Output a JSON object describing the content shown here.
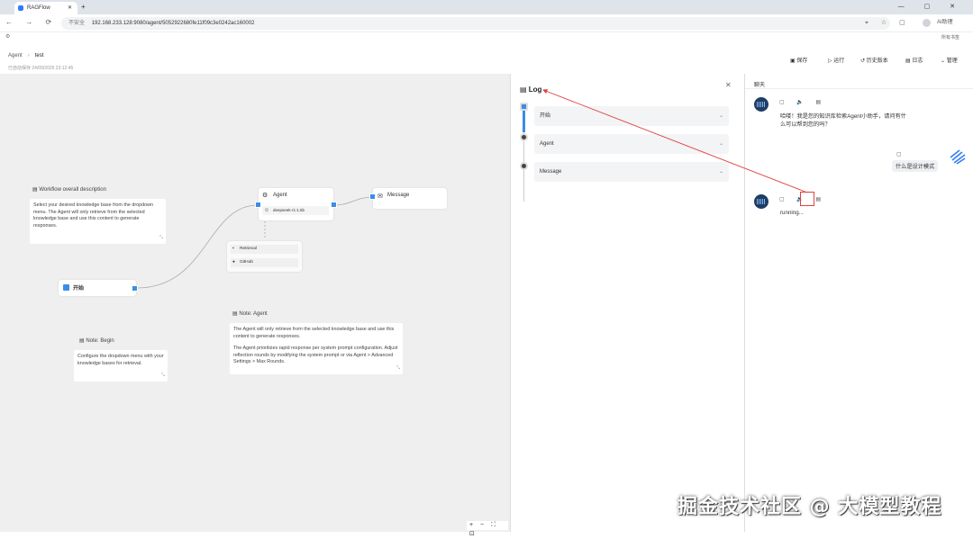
{
  "browser": {
    "tab_title": "RAGFlow",
    "url_prefix": "不安全",
    "url": "192.168.233.128:9080/agent/5052922680fe11f09c3e0242ac160002",
    "bookmark_right": "所有书签",
    "relaunch": "AI助理"
  },
  "header": {
    "crumb_root": "Agent",
    "crumb_current": "test",
    "saved_at": "已自动保存 24/09/2025 23:12:45",
    "buttons": [
      "保存",
      "运行",
      "历史版本",
      "日志",
      "管理"
    ]
  },
  "canvas": {
    "workflow_note_title": "Workflow overall description",
    "workflow_note_body": "Select your desired knowledge base from the dropdown menu. The Agent will only retrieve from the selected knowledge base and use this content to generate responses.",
    "begin_label": "开始",
    "agent_label": "Agent",
    "agent_model": "deepseek-r1:1.5b",
    "message_label": "Message",
    "tools": [
      "Retrieval",
      "GitHub"
    ],
    "note_agent_title": "Note: Agent",
    "note_agent_body": "The Agent will only retrieve from the selected knowledge base and use this content to generate responses.",
    "note_agent_body2": "The Agent prioritizes rapid response per system prompt configuration. Adjust reflection rounds by modifying the system prompt or via Agent > Advanced Settings > Max Rounds.",
    "note_begin_title": "Note: Begin",
    "note_begin_body": "Configure the dropdown menu with your knowledge bases for retrieval."
  },
  "log": {
    "title": "Log",
    "items": [
      "开始",
      "Agent",
      "Message"
    ]
  },
  "chat": {
    "title": "聊天",
    "greeting": "哈喽！我是您的知识库检索Agent小助手，请问有什么可以帮到您的吗？",
    "greeting_line1": "哈喽！我是您的知识库检索Agent小助手，请问有什",
    "greeting_line2": "么可以帮到您的吗？",
    "user_message": "什么是设计模式",
    "status": "running..."
  },
  "watermark": "掘金技术社区 @ 大模型教程",
  "colors": {
    "accent": "#3b8ce8",
    "highlight": "#e04040",
    "canvas_bg": "#efefef"
  }
}
